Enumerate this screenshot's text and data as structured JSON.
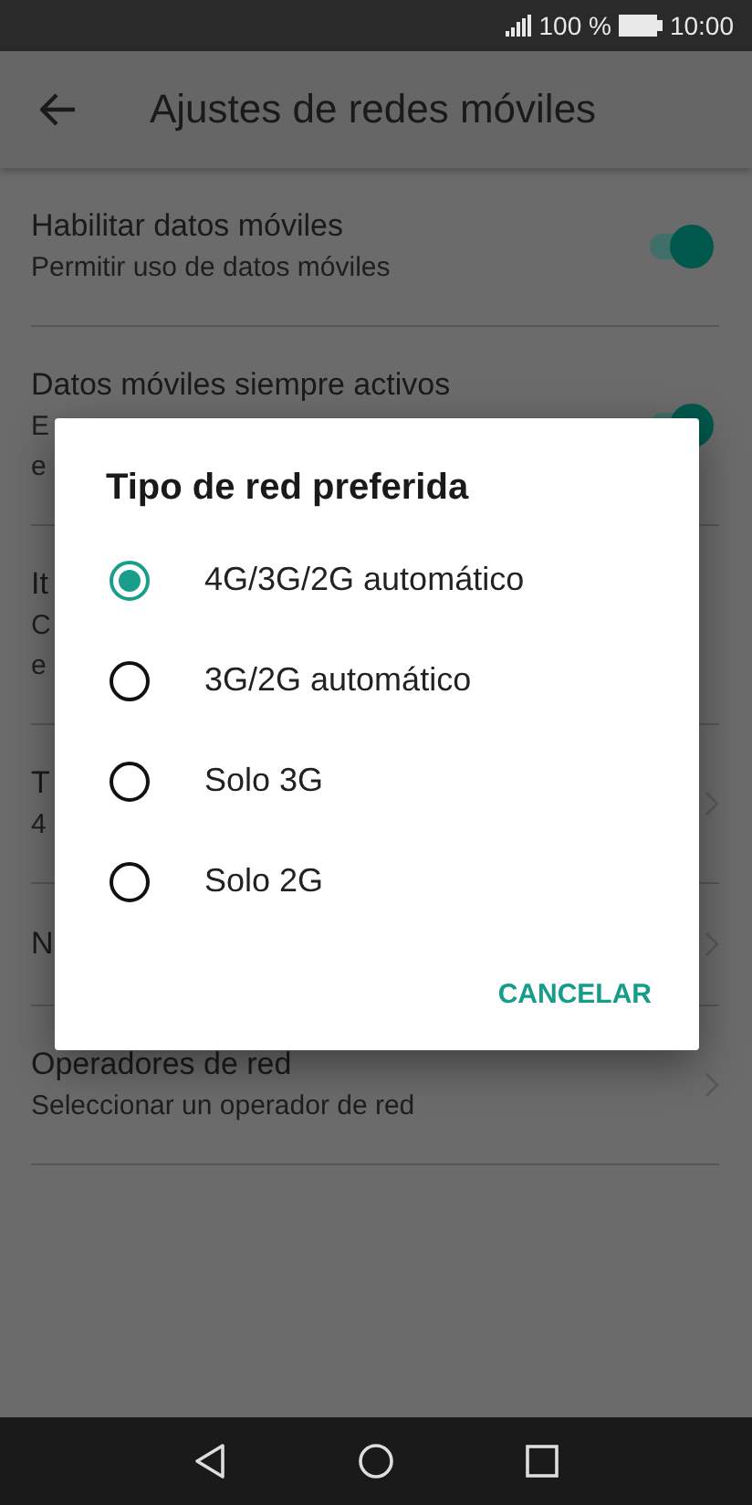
{
  "status_bar": {
    "battery_text": "100 %",
    "time": "10:00"
  },
  "toolbar": {
    "title": "Ajustes de redes móviles"
  },
  "settings": [
    {
      "kind": "switch",
      "title": "Habilitar datos móviles",
      "subtitle_lines": [
        "Permitir uso de datos móviles"
      ],
      "on": true
    },
    {
      "kind": "switch",
      "title": "Datos móviles siempre activos",
      "subtitle_lines": [
        "E",
        "e"
      ],
      "on": true
    },
    {
      "kind": "plain",
      "title": "It",
      "subtitle_lines": [
        "C",
        "e"
      ]
    },
    {
      "kind": "link",
      "title": "T",
      "subtitle_lines": [
        "4"
      ]
    },
    {
      "kind": "link",
      "title": "N"
    },
    {
      "kind": "link",
      "title": "Operadores de red",
      "subtitle_lines": [
        "Seleccionar un operador de red"
      ]
    }
  ],
  "dialog": {
    "title": "Tipo de red preferida",
    "options": [
      {
        "label": "4G/3G/2G automático",
        "selected": true
      },
      {
        "label": "3G/2G automático",
        "selected": false
      },
      {
        "label": "Solo 3G",
        "selected": false
      },
      {
        "label": "Solo 2G",
        "selected": false
      }
    ],
    "button": "CANCELAR"
  }
}
